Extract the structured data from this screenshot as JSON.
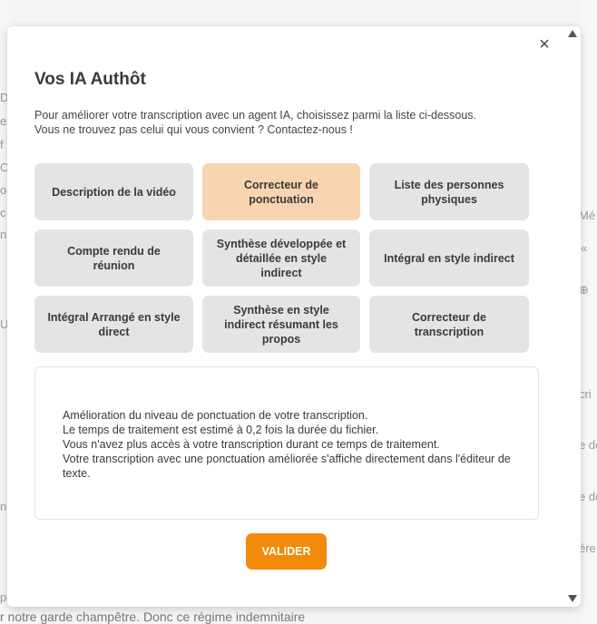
{
  "background": {
    "left_fragments": [
      "D",
      "e",
      "f",
      "Or",
      "ou",
      "c",
      "n",
      "Ur",
      "na",
      "pe"
    ],
    "right_fragments": [
      "Mé",
      "«",
      "⊕",
      "cri",
      "e de",
      "e de",
      "ére"
    ],
    "bottom_text": "r notre garde champêtre. Donc ce régime indemnitaire"
  },
  "modal": {
    "title": "Vos IA Authôt",
    "intro_lines": [
      "Pour améliorer votre transcription avec un agent IA, choisissez parmi la liste ci-dessous.",
      "Vous ne trouvez pas celui qui vous convient ? Contactez-nous !"
    ],
    "close_symbol": "×",
    "agents": [
      {
        "label": "Description de la vidéo",
        "selected": false
      },
      {
        "label": "Correcteur de ponctuation",
        "selected": true
      },
      {
        "label": "Liste des personnes physiques",
        "selected": false
      },
      {
        "label": "Compte rendu de réunion",
        "selected": false
      },
      {
        "label": "Synthèse développée et détaillée en style indirect",
        "selected": false
      },
      {
        "label": "Intégral en style indirect",
        "selected": false
      },
      {
        "label": "Intégral Arrangé en style direct",
        "selected": false
      },
      {
        "label": "Synthèse en style indirect résumant les propos",
        "selected": false
      },
      {
        "label": "Correcteur de transcription",
        "selected": false
      }
    ],
    "description_lines": [
      "Amélioration du niveau de ponctuation de votre transcription.",
      "Le temps de traitement est estimé à 0,2 fois la durée du fichier.",
      "Vous n'avez plus accès à votre transcription durant ce temps de traitement.",
      "Votre transcription avec une ponctuation améliorée s'affiche directement dans l'éditeur de texte."
    ],
    "validate_label": "VALIDER"
  },
  "colors": {
    "selected_agent": "#f8d4b0",
    "agent": "#e4e4e4",
    "accent_button": "#f28a0b"
  },
  "icons": [
    "close-icon",
    "scroll-up-arrow-icon",
    "scroll-down-arrow-icon"
  ]
}
